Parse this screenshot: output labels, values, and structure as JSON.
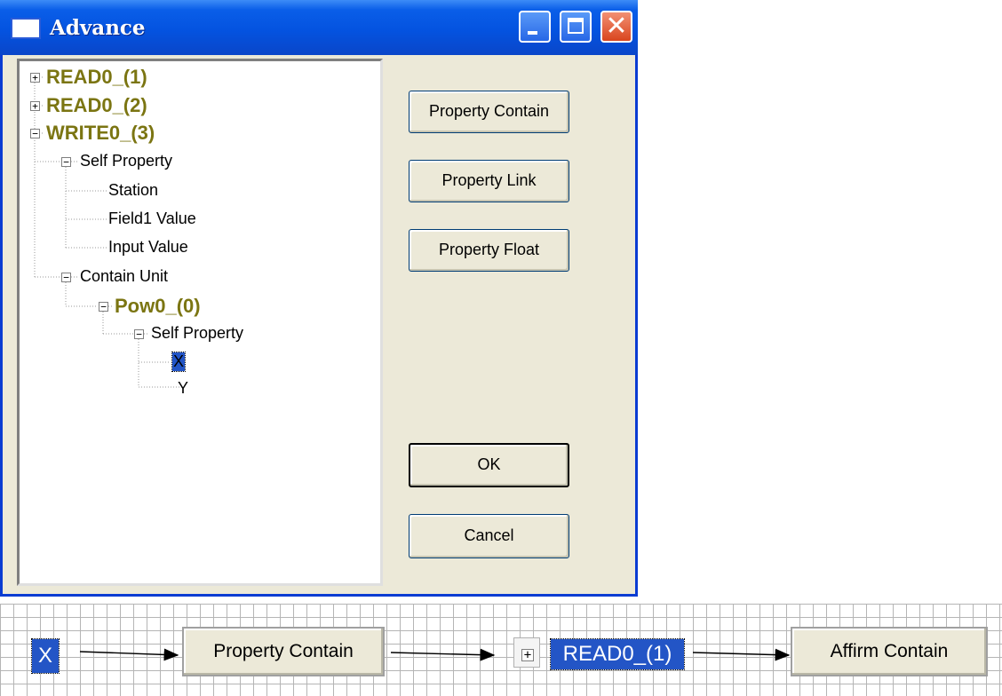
{
  "window": {
    "title": "Advance"
  },
  "tree": {
    "items": [
      {
        "label": "READ0_(1)",
        "toggle": "+"
      },
      {
        "label": "READ0_(2)",
        "toggle": "+"
      },
      {
        "label": "WRITE0_(3)",
        "toggle": "−"
      },
      {
        "label": "Self Property",
        "toggle": "−"
      },
      {
        "label": "Station"
      },
      {
        "label": "Field1 Value"
      },
      {
        "label": "Input Value"
      },
      {
        "label": "Contain Unit",
        "toggle": "−"
      },
      {
        "label": "Pow0_(0)",
        "toggle": "−"
      },
      {
        "label": "Self Property",
        "toggle": "−"
      },
      {
        "label": "X",
        "selected": true
      },
      {
        "label": "Y"
      }
    ]
  },
  "buttons": {
    "property_contain": "Property Contain",
    "property_link": "Property Link",
    "property_float": "Property Float",
    "ok": "OK",
    "cancel": "Cancel"
  },
  "diagram": {
    "x_node": "X",
    "property_contain": "Property Contain",
    "read_node": "READ0_(1)",
    "read_toggle": "+",
    "affirm_contain": "Affirm Contain"
  },
  "colors": {
    "titlebar": "#0453e0",
    "window_bg": "#ece9d8",
    "tree_bold_text": "#7b7512",
    "selection": "#2355c6"
  }
}
